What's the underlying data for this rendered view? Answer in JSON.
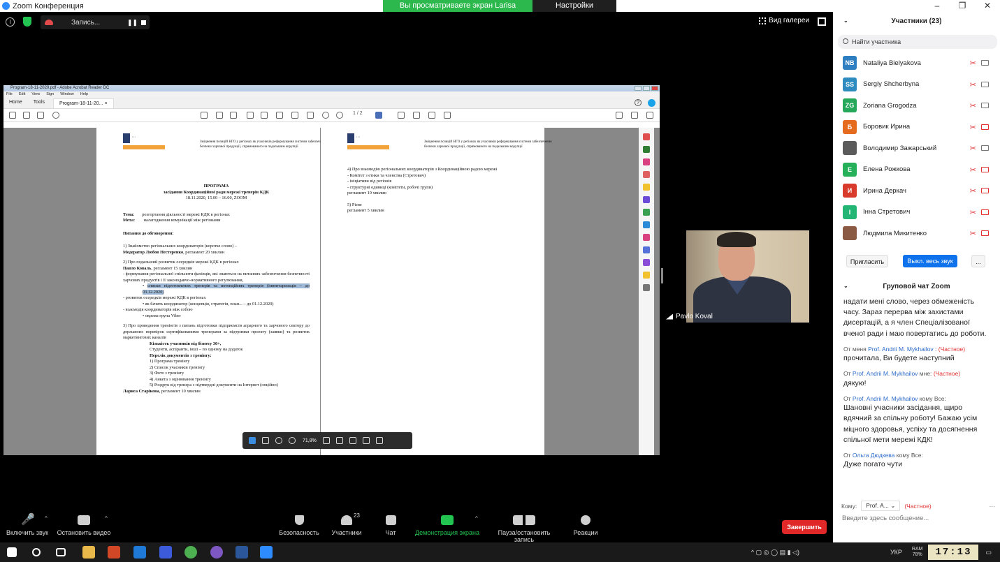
{
  "window": {
    "title": "Zoom Конференция"
  },
  "share_banner": {
    "viewing": "Вы просматриваете экран Larisa Starikova",
    "options": "Настройки просмотра ⌄"
  },
  "topbar": {
    "recording": "Запись...",
    "gallery": "Вид галереи"
  },
  "acrobat": {
    "title": "Program-18-11-2020.pdf - Adobe Acrobat Reader DC",
    "menu": [
      "File",
      "Edit",
      "View",
      "Sign",
      "Window",
      "Help"
    ],
    "tabs": {
      "home": "Home",
      "tools": "Tools",
      "doc": "Program-18-11-20...",
      "close": "×"
    },
    "page_indicator": "1 / 2",
    "zoom": "71,8%"
  },
  "doc": {
    "header": "Зміцнення позицій НГО у регіонах як учасників реформування системи забезпечення безпеки харчової продукції, спрямованого на подальшим корупції",
    "title": "ПРОГРАМА",
    "subtitle": "засідання Координаційної ради мережі тренерів КДК",
    "date": "18.11.2020, 15.00 – 16.00, ZOOM",
    "topic_label": "Тема:",
    "topic": "розгортання діяльності мережі КДК в регіонах",
    "goal_label": "Мета:",
    "goal": "налагодження комунікації між регіонами",
    "discuss": "Питання до обговорення:",
    "item1": "1)      Знайомство регіональних координаторів (коротке слово) –",
    "item1b": "Модератор Любов Нестеренко",
    "item1c": ", регламент 20 хвилин",
    "item2": "2)      Про подальший розвиток осередків мережі КДК в регіонах",
    "item2b": "Павло Коваль",
    "item2c": ", регламент 15 хвилин",
    "item2d": "- формування регіональної спільноти фахівців, які знаються на питаннях забезпечення безпечності харчових продуктів і її законодавчо-нормативного регулювання,",
    "item2e": "списки підготовлених тренерів та потенційних тренерів (інвентаризація – до 03.12.2020)",
    "item2f": "-  розвиток осередків мережі КДК в регіонах",
    "item2g": "як бачить координатор (концепція, стратегія, план... – до 01.12.2020)",
    "item2h": "- взаємодія координаторів між собою",
    "item2i": "окрема група Viber",
    "item3": "3) Про проведення тренінгів з питань підготовки підприємств аграрного та харчового сектору до державних перевірок сертифікованими тренерами за підтримки проекту (заявки) та розвиток маркетингових каналів",
    "item3a": "Кількість учасників від бізнесу 30+,",
    "item3b": "Студенти, аспіранти, інші – по одному на додаток",
    "item3c": "Перелік документів з тренінгу:",
    "item3d": "1) Програма тренінгу",
    "item3e": "2) Список учасників тренінгу",
    "item3f": "3) Фото з тренінгу",
    "item3g": "4) Анкета з оцінювання тренінгу",
    "item3h": "5) Роздрук від тренера з підтвердні документи на Інтернет (опційно)",
    "item3i": "Лариса Старікова",
    "item3j": ", регламент 10 хвилин",
    "p2_item4": "4)      Про взаємодію регіональних координаторів з Координаційною радою мережі",
    "p2_a": "- Комітет з етики та членства (Стретович)",
    "p2_b": "- ініціативи від регіонів",
    "p2_c": "- структурні одиниці (комітети, робочі групи)",
    "p2_d": "регламент 10 хвилин",
    "p2_item5": "5)      Різне",
    "p2_e": "регламент 5 хвилин"
  },
  "video": {
    "name": "Pavlo Koval"
  },
  "toolbar": {
    "mic": "Включить звук",
    "video": "Остановить видео",
    "security": "Безопасность",
    "participants": "Участники",
    "participants_count": "23",
    "chat": "Чат",
    "share": "Демонстрация экрана",
    "record": "Пауза/остановить запись",
    "reactions": "Реакции",
    "end": "Завершить"
  },
  "panel": {
    "title": "Участники (23)",
    "search_placeholder": "Найти участника",
    "participants": [
      {
        "initials": "NB",
        "name": "Nataliya Bielyakova",
        "color": "#2e7fc2",
        "cam_off": false
      },
      {
        "initials": "SS",
        "name": "Sergiy Shcherbyna",
        "color": "#2e8bc0",
        "cam_off": false
      },
      {
        "initials": "ZG",
        "name": "Zoriana Grogodza",
        "color": "#26a85a",
        "cam_off": false
      },
      {
        "initials": "Б",
        "name": "Боровик Ирина",
        "color": "#e56b1f",
        "cam_off": true
      },
      {
        "initials": "",
        "name": "Володимир Зажарський",
        "color": "#5b5b5b",
        "cam_off": false
      },
      {
        "initials": "Е",
        "name": "Елена Рожкова",
        "color": "#26b05a",
        "cam_off": true
      },
      {
        "initials": "И",
        "name": "Ирина Деркач",
        "color": "#d83b2b",
        "cam_off": true
      },
      {
        "initials": "І",
        "name": "Інна Стретович",
        "color": "#22b573",
        "cam_off": true
      },
      {
        "initials": "",
        "name": "Людмила Микитенко",
        "color": "#8a5a44",
        "cam_off": true
      }
    ],
    "invite": "Пригласить",
    "mute_all": "Выкл. весь звук",
    "more": "...",
    "chat_title": "Груповой чат Zoom",
    "chat": [
      {
        "from": "",
        "to": "",
        "private": "",
        "text": "надати мені слово, через обмеженість часу. Зараз перерва між захистами дисертацій, а я член Спеціалізованої вченої ради і маю повертатись до роботи."
      },
      {
        "from": "Prof. Andrii M. Mykhailov",
        "prefix": "От меня",
        "mid": "",
        "to": ":",
        "private": "(Частное)",
        "text": "прочитала, Ви будете наступний"
      },
      {
        "from": "Prof. Andrii M. Mykhailov",
        "prefix": "От",
        "mid": "",
        "to": "мне:",
        "private": "(Частное)",
        "text": "дякую!"
      },
      {
        "from": "Prof. Andrii M. Mykhailov",
        "prefix": "От",
        "mid": "",
        "to": "кому Все:",
        "private": "",
        "text": "Шановні учасники засідання, щиро вдячний за спільну роботу! Бажаю усім міцного здоровья, успіху та досягнення спільної мети мережі КДК!"
      },
      {
        "from": "Ольга Дюдкева",
        "prefix": "От",
        "mid": "",
        "to": "кому Все:",
        "private": "",
        "text": "Дуже погато чути"
      }
    ],
    "to_label": "Кому:",
    "to_value": "Prof. A... ⌄",
    "to_private": "(Частное)",
    "input_placeholder": "Введите здесь сообщение..."
  },
  "taskbar": {
    "lang": "УКР",
    "clock": "17:13",
    "ram_label": "RAM",
    "ram_value": "78%"
  }
}
